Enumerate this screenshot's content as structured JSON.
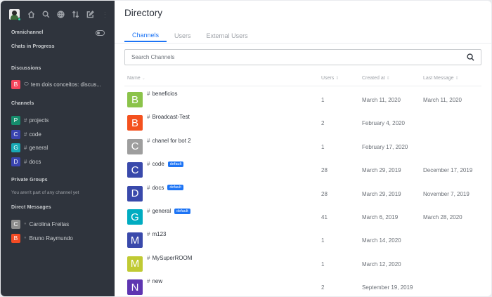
{
  "sidebar": {
    "sections": {
      "omnichannel": "Omnichannel",
      "chats_in_progress": "Chats in Progress",
      "discussions": "Discussions",
      "channels": "Channels",
      "private_groups": "Private Groups",
      "direct_messages": "Direct Messages"
    },
    "discussion": {
      "letter": "B",
      "label": "tem dois conceitos: discus...",
      "color": "#f5455c"
    },
    "channels": [
      {
        "letter": "P",
        "label": "projects",
        "color": "#158d6c"
      },
      {
        "letter": "C",
        "label": "code",
        "color": "#3a44b0"
      },
      {
        "letter": "G",
        "label": "general",
        "color": "#18a8b5"
      },
      {
        "letter": "D",
        "label": "docs",
        "color": "#3a44b0"
      }
    ],
    "private_groups_empty": "You aren't part of any channel yet",
    "direct_messages": [
      {
        "letter": "C",
        "label": "Carolina Freitas",
        "color": "#8e8e8e"
      },
      {
        "letter": "B",
        "label": "Bruno Raymundo",
        "color": "#f44b24"
      }
    ]
  },
  "header": {
    "title": "Directory"
  },
  "tabs": [
    {
      "label": "Channels",
      "active": true
    },
    {
      "label": "Users",
      "active": false
    },
    {
      "label": "External Users",
      "active": false
    }
  ],
  "search": {
    "placeholder": "Search Channels"
  },
  "columns": {
    "name": "Name",
    "users": "Users",
    "created_at": "Created at",
    "last_message": "Last Message"
  },
  "rows": [
    {
      "letter": "B",
      "color": "#8bc34a",
      "name": "beneficios",
      "badge": "",
      "users": "1",
      "created": "March 11, 2020",
      "last": "March 11, 2020"
    },
    {
      "letter": "B",
      "color": "#f4511e",
      "name": "Broadcast-Test",
      "badge": "",
      "users": "2",
      "created": "February 4, 2020",
      "last": ""
    },
    {
      "letter": "C",
      "color": "#9e9e9e",
      "name": "chanel for bot 2",
      "badge": "",
      "users": "1",
      "created": "February 17, 2020",
      "last": ""
    },
    {
      "letter": "C",
      "color": "#3949ab",
      "name": "code",
      "badge": "default",
      "users": "28",
      "created": "March 29, 2019",
      "last": "December 17, 2019"
    },
    {
      "letter": "D",
      "color": "#3949ab",
      "name": "docs",
      "badge": "default",
      "users": "28",
      "created": "March 29, 2019",
      "last": "November 7, 2019"
    },
    {
      "letter": "G",
      "color": "#00acc1",
      "name": "general",
      "badge": "default",
      "users": "41",
      "created": "March 6, 2019",
      "last": "March 28, 2020"
    },
    {
      "letter": "M",
      "color": "#3949ab",
      "name": "m123",
      "badge": "",
      "users": "1",
      "created": "March 14, 2020",
      "last": ""
    },
    {
      "letter": "M",
      "color": "#c0ca33",
      "name": "MySuperROOM",
      "badge": "",
      "users": "1",
      "created": "March 12, 2020",
      "last": ""
    },
    {
      "letter": "N",
      "color": "#5e35b1",
      "name": "new",
      "badge": "",
      "users": "2",
      "created": "September 19, 2019",
      "last": ""
    }
  ]
}
